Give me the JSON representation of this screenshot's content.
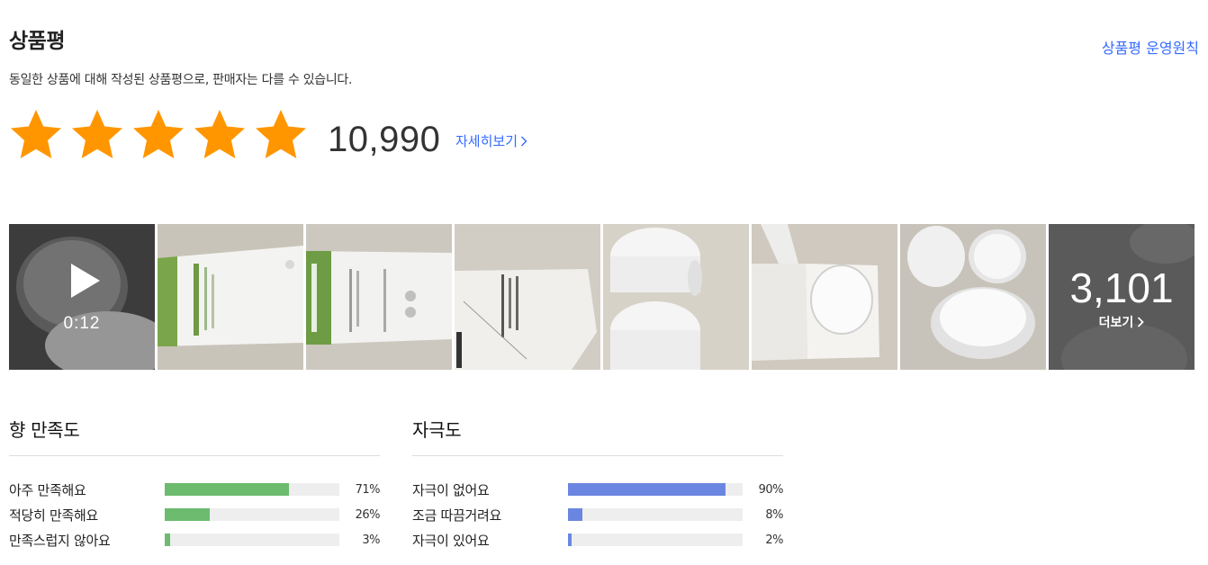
{
  "header": {
    "title": "상품평",
    "policy_link": "상품평 운영원칙",
    "subtitle": "동일한 상품에 대해 작성된 상품평으로, 판매자는 다를 수 있습니다."
  },
  "rating": {
    "stars": 5,
    "count": "10,990",
    "detail_link": "자세히보기",
    "star_color": "#ff9600"
  },
  "photos": {
    "video_time": "0:12",
    "more_count": "3,101",
    "more_label": "더보기"
  },
  "surveys": [
    {
      "title": "향 만족도",
      "bar_color": "#6cbb6e",
      "rows": [
        {
          "label": "아주 만족해요",
          "pct": "71%",
          "value": 71
        },
        {
          "label": "적당히 만족해요",
          "pct": "26%",
          "value": 26
        },
        {
          "label": "만족스럽지 않아요",
          "pct": "3%",
          "value": 3
        }
      ]
    },
    {
      "title": "자극도",
      "bar_color": "#6b86e0",
      "rows": [
        {
          "label": "자극이 없어요",
          "pct": "90%",
          "value": 90
        },
        {
          "label": "조금 따끔거려요",
          "pct": "8%",
          "value": 8
        },
        {
          "label": "자극이 있어요",
          "pct": "2%",
          "value": 2
        }
      ]
    }
  ]
}
